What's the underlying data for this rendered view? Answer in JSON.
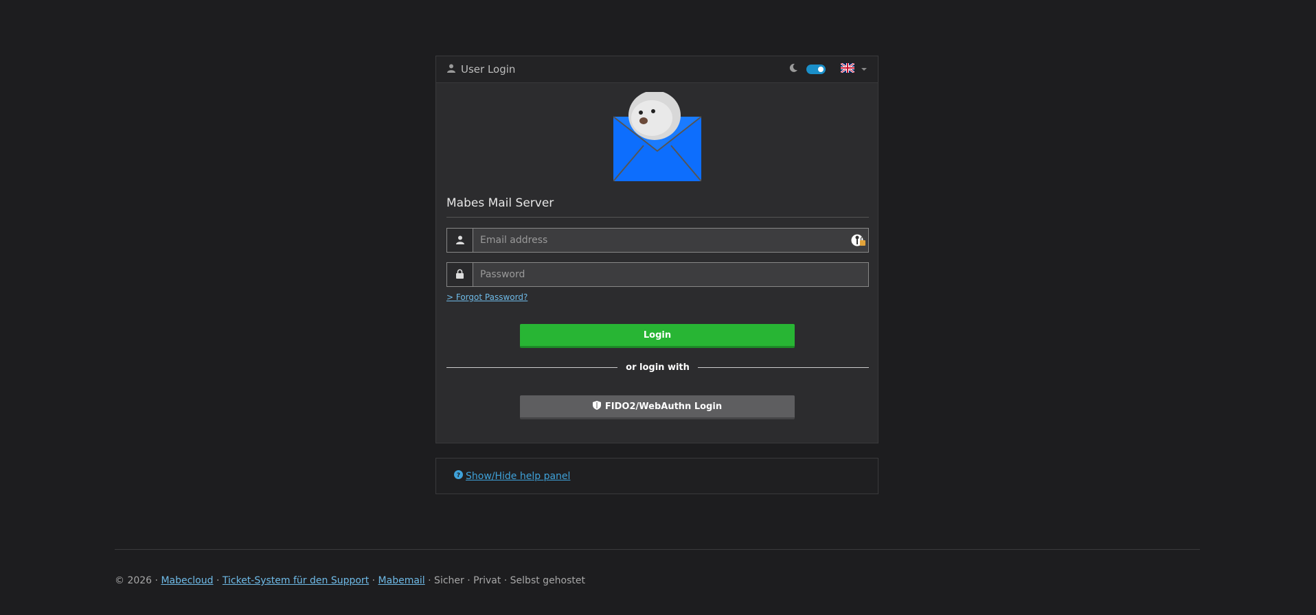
{
  "header": {
    "title": "User Login",
    "user_icon": "user-icon",
    "moon_icon": "moon-icon",
    "dark_mode": true,
    "language_flag": "uk-flag-icon"
  },
  "brand": {
    "name": "Mabes Mail Server"
  },
  "form": {
    "email_placeholder": "Email address",
    "password_placeholder": "Password",
    "forgot_label": "> Forgot Password?",
    "login_label": "Login",
    "divider_label": "or login with",
    "fido_label": "FIDO2/WebAuthn Login"
  },
  "help": {
    "label": "Show/Hide help panel"
  },
  "footer": {
    "copyright": "© 2026 · ",
    "link1": "Mabecloud",
    "sep1": " · ",
    "link2": "Ticket-System für den Support",
    "sep2": " · ",
    "link3": "Mabemail",
    "tail": " · Sicher · Privat · Selbst gehostet"
  },
  "colors": {
    "background": "#1d1d1f",
    "card": "#2c2c2e",
    "login_button": "#28b534",
    "link": "#6fbbe8",
    "toggle": "#1a8fc9"
  }
}
